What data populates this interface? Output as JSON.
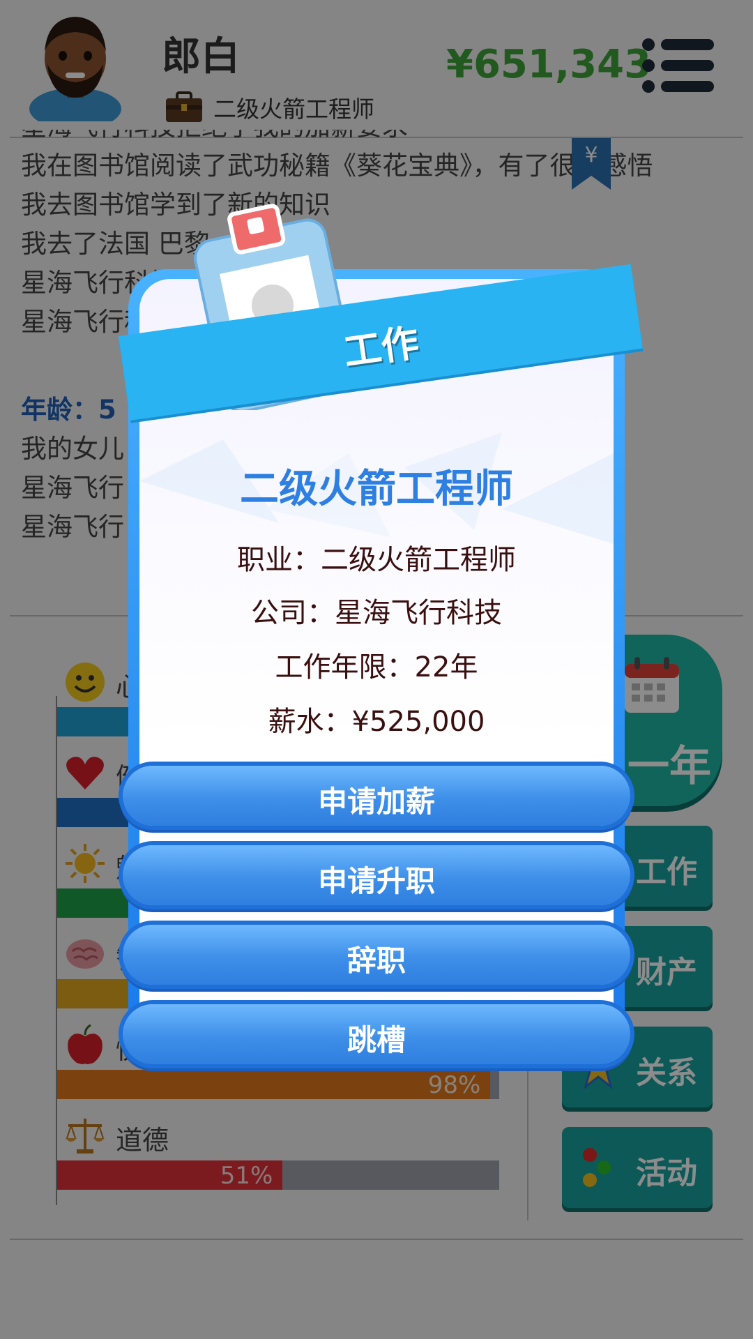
{
  "player": {
    "name": "郎白",
    "job": "二级火箭工程师",
    "money": "¥651,343"
  },
  "log": {
    "lines_a": [
      "星海飞行科技拒绝了我的加薪要求",
      "我在图书馆阅读了武功秘籍《葵花宝典》，有了很多感悟",
      "我去图书馆学到了新的知识",
      "我去了法国 巴黎",
      "星海飞行科技",
      "星海飞行科技"
    ],
    "age_line": "年龄：5",
    "lines_b": [
      "我的女儿",
      "星海飞行",
      "星海飞行"
    ]
  },
  "stats": [
    {
      "label": "心",
      "icon": "smiley-icon",
      "value": 0.6,
      "color": "#1ea0d4"
    },
    {
      "label": "健",
      "icon": "heart-icon",
      "value": 0.55,
      "color": "#1e6fc4"
    },
    {
      "label": "魅",
      "icon": "sun-icon",
      "value": 0.5,
      "color": "#1fa04a"
    },
    {
      "label": "智",
      "icon": "brain-icon",
      "value": 0.45,
      "color": "#e0a81e"
    },
    {
      "label": "快",
      "icon": "apple-icon",
      "value": 0.98,
      "pct": "98%",
      "color": "#e0781e"
    },
    {
      "label": "道德",
      "icon": "scales-icon",
      "value": 0.51,
      "pct": "51%",
      "color": "#e0303a"
    }
  ],
  "side": {
    "year_label": "一年",
    "work_label": "工作",
    "assets_label": "财产",
    "relations_label": "关系",
    "activities_label": "活动"
  },
  "modal": {
    "title": "工作",
    "job_title": "二级火箭工程师",
    "occupation": "职业：二级火箭工程师",
    "company": "公司：星海飞行科技",
    "years": "工作年限：22年",
    "salary": "薪水：¥525,000",
    "actions": [
      "申请加薪",
      "申请升职",
      "辞职",
      "跳槽"
    ]
  }
}
